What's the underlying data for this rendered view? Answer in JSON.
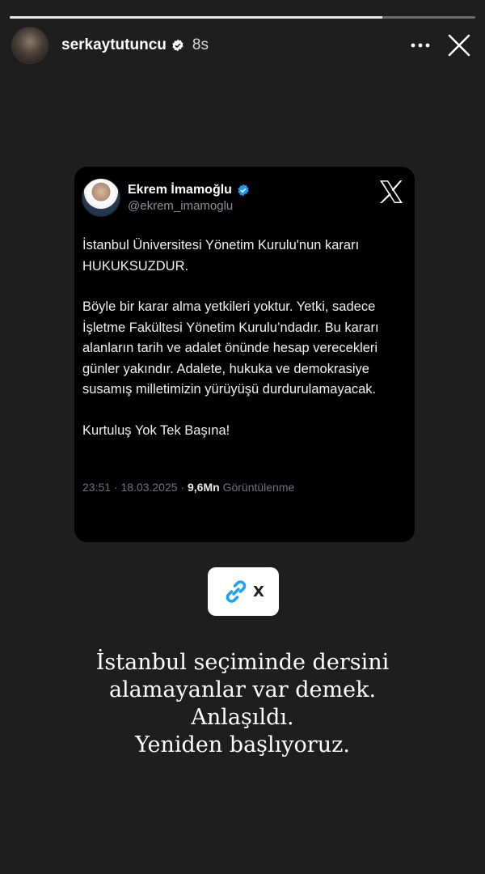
{
  "story": {
    "progress_fraction": 0.8,
    "username": "serkaytutuncu",
    "time_ago": "8s",
    "icons": [
      "verified-icon",
      "more-icon",
      "close-icon"
    ]
  },
  "tweet": {
    "name": "Ekrem İmamoğlu",
    "handle": "@ekrem_imamoglu",
    "paragraphs": [
      "İstanbul Üniversitesi Yönetim Kurulu'nun kararı HUKUKSUZDUR.",
      "Böyle bir karar alma yetkileri yoktur. Yetki, sadece İşletme Fakültesi Yönetim Kurulu’ndadır. Bu kararı alanların tarih ve adalet önünde hesap verecekleri günler yakındır. Adalete, hukuka ve demokrasiye susamış milletimizin yürüyüşü durdurulamayacak.",
      "Kurtuluş Yok Tek Başına!"
    ],
    "datetime": "23:51 · 18.03.2025 · ",
    "views_count": "9,6Mn",
    "views_label": " Görüntülenme"
  },
  "sticker": {
    "label": "X",
    "icon": "link-icon"
  },
  "caption": {
    "lines": [
      "İstanbul seçiminde dersini",
      "alamayanlar var demek.",
      "Anlaşıldı.",
      "Yeniden başlıyoruz."
    ]
  },
  "colors": {
    "background": "#1e1e1e",
    "card": "#000000",
    "verified": "#1d9bf0",
    "link": "#1da1f2"
  }
}
